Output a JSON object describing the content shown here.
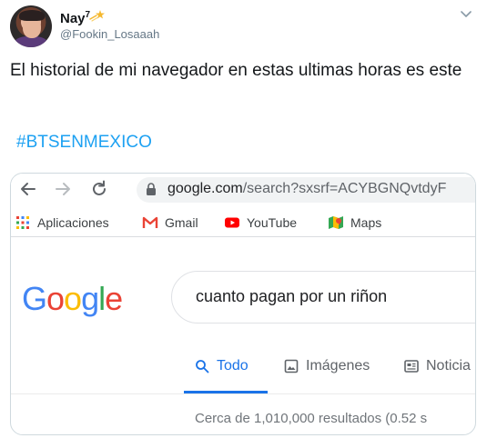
{
  "tweet": {
    "display_name": "Nay",
    "name_sup": "7",
    "handle": "@Fookin_Losaaah",
    "text": "El historial de mi navegador en estas ultimas horas es este",
    "hashtag": "#BTSENMEXICO"
  },
  "browser": {
    "url_host": "google.com",
    "url_path": "/search?sxsrf=ACYBGNQvtdyF",
    "bookmarks": [
      "Aplicaciones",
      "Gmail",
      "YouTube",
      "Maps"
    ]
  },
  "google": {
    "logo_letters": [
      "G",
      "o",
      "o",
      "g",
      "l",
      "e"
    ],
    "logo_colors": [
      "#4285f4",
      "#ea4335",
      "#fbbc05",
      "#4285f4",
      "#34a853",
      "#ea4335"
    ],
    "search_query": "cuanto pagan por un riñon",
    "tabs": [
      "Todo",
      "Imágenes",
      "Noticia"
    ],
    "active_tab": "Todo",
    "results_text": "Cerca de 1,010,000 resultados (0.52 s"
  },
  "colors": {
    "link_blue": "#1da1f2",
    "google_blue": "#1a73e8"
  }
}
